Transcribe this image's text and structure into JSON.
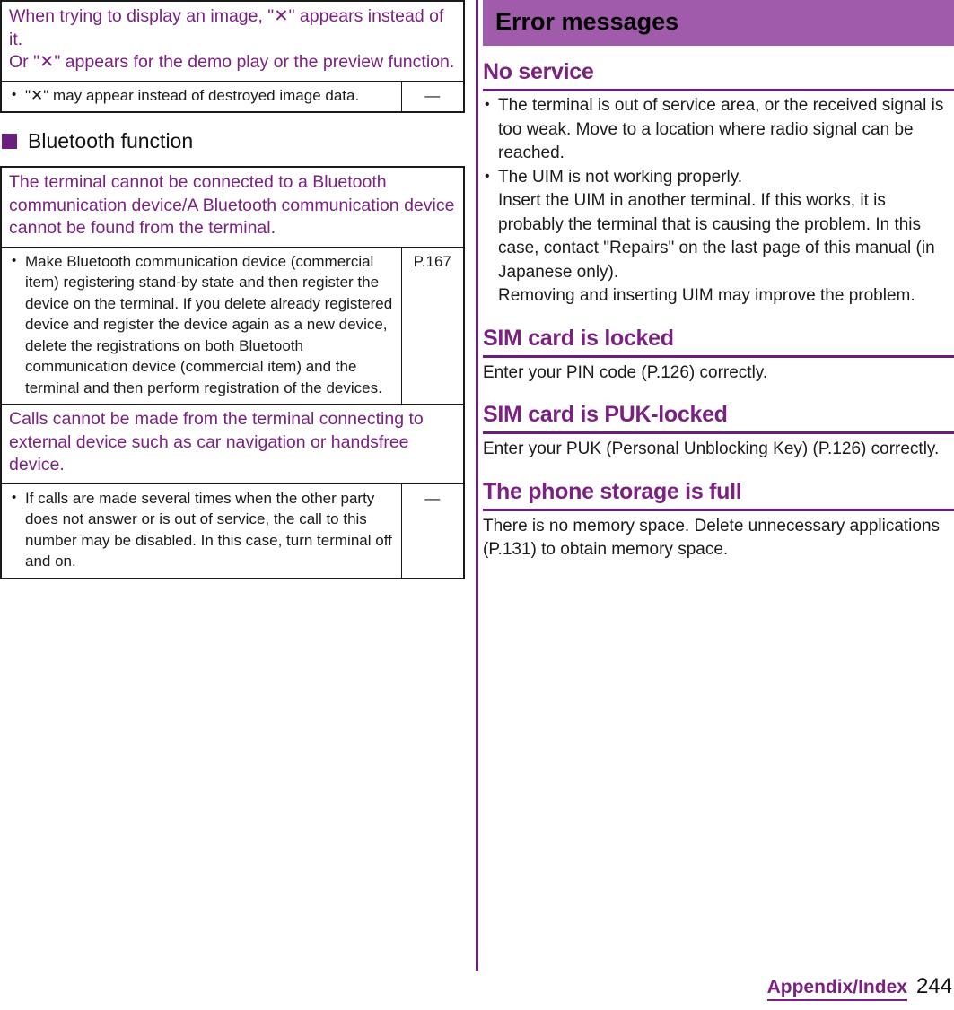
{
  "colors": {
    "heading_purple": "#7b2182",
    "marker_purple": "#6b1f7c",
    "banner_purple": "#a15bab",
    "text_black": "#1a1a1a"
  },
  "left_column": {
    "table_image": {
      "header": "When trying to display an image, \"✕\" appears instead of it.\nOr \"✕\" appears for the demo play or the preview function.",
      "header_lines": [
        "When trying to display an image, \"✕\" appears instead of it.",
        "Or \"✕\" appears for the demo play or the preview function."
      ],
      "rows": [
        {
          "bullet": "\"✕\" may appear instead of destroyed image data.",
          "reference": "—"
        }
      ]
    },
    "section_heading": {
      "marker": "square-marker",
      "label": "Bluetooth function"
    },
    "table_bluetooth": {
      "groups": [
        {
          "header": "The terminal cannot be connected to a Bluetooth communication device/A Bluetooth communication device cannot be found from the terminal.",
          "bullet": "Make Bluetooth communication device (commercial item) registering stand-by state and then register the device on the terminal. If you delete already registered device and register the device again as a new device, delete the registrations on both Bluetooth communication device (commercial item) and the terminal and then perform registration of the devices.",
          "reference": "P.167"
        },
        {
          "header": "Calls cannot be made from the terminal connecting to external device such as car navigation or handsfree device.",
          "bullet": "If calls are made several times when the other party does not answer or is out of service, the call to this number may be disabled. In this case, turn terminal off and on.",
          "reference": "—"
        }
      ]
    }
  },
  "right_column": {
    "banner_title": "Error messages",
    "sections": [
      {
        "title": "No service",
        "bullets": [
          "The terminal is out of service area, or the received signal is too weak. Move to a location where radio signal can be reached.",
          "The UIM is not working properly.\nInsert the UIM in another terminal. If this works, it is probably the terminal that is causing the problem. In this case, contact \"Repairs\" on the last page of this manual (in Japanese only).\nRemoving and inserting UIM may improve the problem."
        ],
        "paragraph": ""
      },
      {
        "title": "SIM card is locked",
        "bullets": [],
        "paragraph": "Enter your PIN code (P.126) correctly."
      },
      {
        "title": "SIM card is PUK-locked",
        "bullets": [],
        "paragraph": "Enter your PUK (Personal Unblocking Key) (P.126) correctly."
      },
      {
        "title": "The phone storage is full",
        "bullets": [],
        "paragraph": "There is no memory space. Delete unnecessary applications (P.131) to obtain memory space."
      }
    ]
  },
  "footer": {
    "section_label": "Appendix/Index",
    "page_number": "244"
  }
}
